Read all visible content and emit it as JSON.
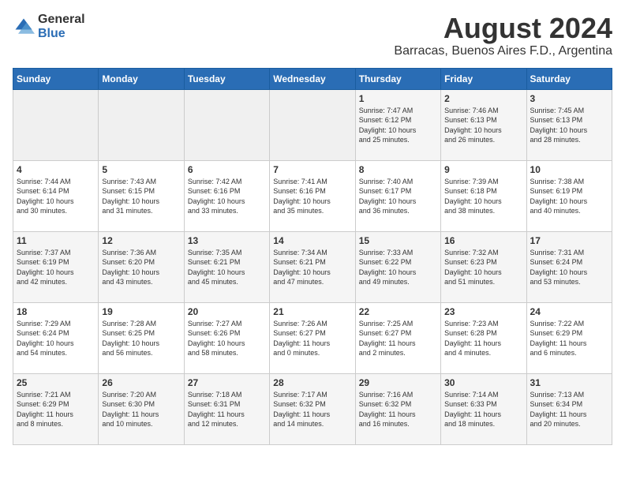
{
  "header": {
    "logo_general": "General",
    "logo_blue": "Blue",
    "month_year": "August 2024",
    "location": "Barracas, Buenos Aires F.D., Argentina"
  },
  "days_of_week": [
    "Sunday",
    "Monday",
    "Tuesday",
    "Wednesday",
    "Thursday",
    "Friday",
    "Saturday"
  ],
  "weeks": [
    [
      {
        "day": "",
        "info": ""
      },
      {
        "day": "",
        "info": ""
      },
      {
        "day": "",
        "info": ""
      },
      {
        "day": "",
        "info": ""
      },
      {
        "day": "1",
        "info": "Sunrise: 7:47 AM\nSunset: 6:12 PM\nDaylight: 10 hours\nand 25 minutes."
      },
      {
        "day": "2",
        "info": "Sunrise: 7:46 AM\nSunset: 6:13 PM\nDaylight: 10 hours\nand 26 minutes."
      },
      {
        "day": "3",
        "info": "Sunrise: 7:45 AM\nSunset: 6:13 PM\nDaylight: 10 hours\nand 28 minutes."
      }
    ],
    [
      {
        "day": "4",
        "info": "Sunrise: 7:44 AM\nSunset: 6:14 PM\nDaylight: 10 hours\nand 30 minutes."
      },
      {
        "day": "5",
        "info": "Sunrise: 7:43 AM\nSunset: 6:15 PM\nDaylight: 10 hours\nand 31 minutes."
      },
      {
        "day": "6",
        "info": "Sunrise: 7:42 AM\nSunset: 6:16 PM\nDaylight: 10 hours\nand 33 minutes."
      },
      {
        "day": "7",
        "info": "Sunrise: 7:41 AM\nSunset: 6:16 PM\nDaylight: 10 hours\nand 35 minutes."
      },
      {
        "day": "8",
        "info": "Sunrise: 7:40 AM\nSunset: 6:17 PM\nDaylight: 10 hours\nand 36 minutes."
      },
      {
        "day": "9",
        "info": "Sunrise: 7:39 AM\nSunset: 6:18 PM\nDaylight: 10 hours\nand 38 minutes."
      },
      {
        "day": "10",
        "info": "Sunrise: 7:38 AM\nSunset: 6:19 PM\nDaylight: 10 hours\nand 40 minutes."
      }
    ],
    [
      {
        "day": "11",
        "info": "Sunrise: 7:37 AM\nSunset: 6:19 PM\nDaylight: 10 hours\nand 42 minutes."
      },
      {
        "day": "12",
        "info": "Sunrise: 7:36 AM\nSunset: 6:20 PM\nDaylight: 10 hours\nand 43 minutes."
      },
      {
        "day": "13",
        "info": "Sunrise: 7:35 AM\nSunset: 6:21 PM\nDaylight: 10 hours\nand 45 minutes."
      },
      {
        "day": "14",
        "info": "Sunrise: 7:34 AM\nSunset: 6:21 PM\nDaylight: 10 hours\nand 47 minutes."
      },
      {
        "day": "15",
        "info": "Sunrise: 7:33 AM\nSunset: 6:22 PM\nDaylight: 10 hours\nand 49 minutes."
      },
      {
        "day": "16",
        "info": "Sunrise: 7:32 AM\nSunset: 6:23 PM\nDaylight: 10 hours\nand 51 minutes."
      },
      {
        "day": "17",
        "info": "Sunrise: 7:31 AM\nSunset: 6:24 PM\nDaylight: 10 hours\nand 53 minutes."
      }
    ],
    [
      {
        "day": "18",
        "info": "Sunrise: 7:29 AM\nSunset: 6:24 PM\nDaylight: 10 hours\nand 54 minutes."
      },
      {
        "day": "19",
        "info": "Sunrise: 7:28 AM\nSunset: 6:25 PM\nDaylight: 10 hours\nand 56 minutes."
      },
      {
        "day": "20",
        "info": "Sunrise: 7:27 AM\nSunset: 6:26 PM\nDaylight: 10 hours\nand 58 minutes."
      },
      {
        "day": "21",
        "info": "Sunrise: 7:26 AM\nSunset: 6:27 PM\nDaylight: 11 hours\nand 0 minutes."
      },
      {
        "day": "22",
        "info": "Sunrise: 7:25 AM\nSunset: 6:27 PM\nDaylight: 11 hours\nand 2 minutes."
      },
      {
        "day": "23",
        "info": "Sunrise: 7:23 AM\nSunset: 6:28 PM\nDaylight: 11 hours\nand 4 minutes."
      },
      {
        "day": "24",
        "info": "Sunrise: 7:22 AM\nSunset: 6:29 PM\nDaylight: 11 hours\nand 6 minutes."
      }
    ],
    [
      {
        "day": "25",
        "info": "Sunrise: 7:21 AM\nSunset: 6:29 PM\nDaylight: 11 hours\nand 8 minutes."
      },
      {
        "day": "26",
        "info": "Sunrise: 7:20 AM\nSunset: 6:30 PM\nDaylight: 11 hours\nand 10 minutes."
      },
      {
        "day": "27",
        "info": "Sunrise: 7:18 AM\nSunset: 6:31 PM\nDaylight: 11 hours\nand 12 minutes."
      },
      {
        "day": "28",
        "info": "Sunrise: 7:17 AM\nSunset: 6:32 PM\nDaylight: 11 hours\nand 14 minutes."
      },
      {
        "day": "29",
        "info": "Sunrise: 7:16 AM\nSunset: 6:32 PM\nDaylight: 11 hours\nand 16 minutes."
      },
      {
        "day": "30",
        "info": "Sunrise: 7:14 AM\nSunset: 6:33 PM\nDaylight: 11 hours\nand 18 minutes."
      },
      {
        "day": "31",
        "info": "Sunrise: 7:13 AM\nSunset: 6:34 PM\nDaylight: 11 hours\nand 20 minutes."
      }
    ]
  ]
}
